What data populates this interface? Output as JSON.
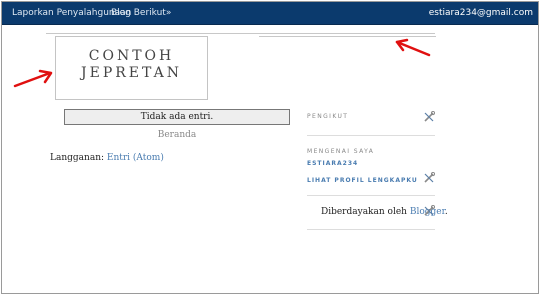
{
  "navbar": {
    "report_label": "Laporkan Penyalahgunaan",
    "next_blog_label": "Blog Berikut»",
    "email": "estiara234@gmail.com"
  },
  "header": {
    "line1": "CONTOH",
    "line2": "JEPRETAN"
  },
  "main": {
    "no_entries": "Tidak ada entri.",
    "home_link": "Beranda",
    "subscribe_prefix": "Langganan: ",
    "subscribe_link": "Entri (Atom)"
  },
  "sidebar": {
    "followers_title": "PENGIKUT",
    "about_title": "MENGENAI SAYA",
    "profile_name": "ESTIARA234",
    "profile_link": "LIHAT PROFIL LENGKAPKU",
    "powered_prefix": "Diberdayakan oleh ",
    "powered_link": "Blogger",
    "powered_suffix": "."
  },
  "colors": {
    "navbar_bg": "#0b3a6d",
    "link": "#4a7cb0",
    "annotation_arrow": "#e01010"
  },
  "icons": {
    "edit": "wrench-screwdriver-icon",
    "annotation": "red-arrow"
  }
}
